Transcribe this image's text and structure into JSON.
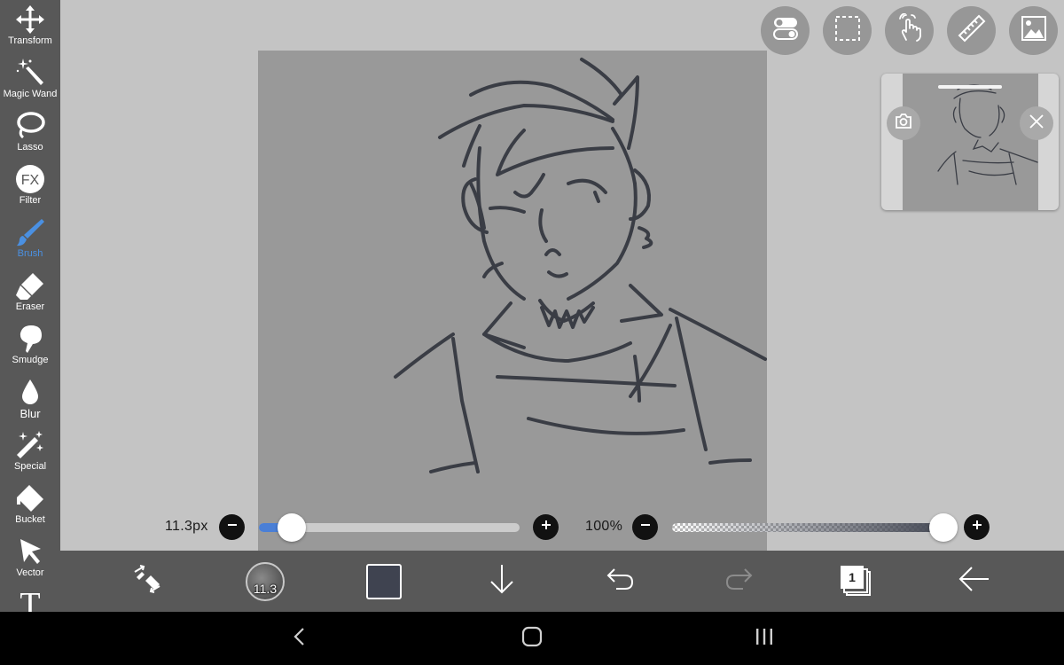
{
  "sidebar": {
    "items": [
      {
        "label": "Transform",
        "icon": "move-arrows-icon"
      },
      {
        "label": "Magic Wand",
        "icon": "magic-wand-icon"
      },
      {
        "label": "Lasso",
        "icon": "lasso-icon"
      },
      {
        "label": "Filter",
        "icon": "fx-filter-icon",
        "glyph": "FX"
      },
      {
        "label": "Brush",
        "icon": "brush-icon",
        "active": true
      },
      {
        "label": "Eraser",
        "icon": "eraser-icon"
      },
      {
        "label": "Smudge",
        "icon": "smudge-icon"
      },
      {
        "label": "Blur",
        "icon": "blur-drop-icon"
      },
      {
        "label": "Special",
        "icon": "sparkle-wand-icon"
      },
      {
        "label": "Bucket",
        "icon": "bucket-icon"
      },
      {
        "label": "Vector",
        "icon": "cursor-arrow-icon"
      },
      {
        "label": "",
        "icon": "text-icon",
        "glyph": "T"
      }
    ]
  },
  "top_buttons": [
    "toggle-icon",
    "selection-icon",
    "touch-gesture-icon",
    "ruler-icon",
    "image-icon"
  ],
  "brush_size": {
    "value_text": "11.3px",
    "fraction": 0.08
  },
  "opacity": {
    "value_text": "100%",
    "fraction": 1.0
  },
  "bottom_bar": {
    "brush_badge": "11.3",
    "layer_count": "1",
    "color": "#3f4350"
  },
  "colors": {
    "sidebar_bg": "#585858",
    "canvas_bg": "#999999",
    "accent": "#4a90e2",
    "stroke": "#3a3d45"
  }
}
